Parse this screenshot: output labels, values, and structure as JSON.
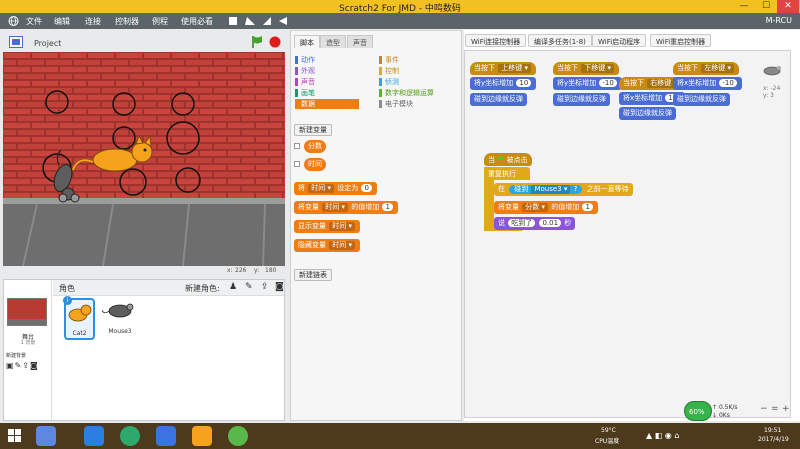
{
  "window": {
    "title": "Scratch2 For JMD - 中鸣数码",
    "min": "—",
    "max": "☐",
    "close": "✕"
  },
  "menu": {
    "items": [
      "文件",
      "编辑",
      "连接",
      "控制器",
      "例程",
      "使用必看"
    ],
    "brand": "M-RCU"
  },
  "stage": {
    "version": "v456",
    "project_title": "Project",
    "coords": {
      "x_label": "x:",
      "x_value": "226",
      "y_label": "y:",
      "y_value": "180"
    }
  },
  "sprites": {
    "header_label": "角色",
    "new_sprite_label": "新建角色:",
    "stage_name": "舞台",
    "stage_backdrops": "1 背景",
    "new_backdrop_label": "新建背景",
    "list": [
      {
        "name": "Cat2",
        "selected": true
      },
      {
        "name": "Mouse3",
        "selected": false
      }
    ]
  },
  "palette": {
    "tabs": [
      "脚本",
      "造型",
      "声音"
    ],
    "categories": [
      {
        "label": "动作",
        "color": "#4a6cd4"
      },
      {
        "label": "外观",
        "color": "#8a55d7"
      },
      {
        "label": "声音",
        "color": "#bb42c3"
      },
      {
        "label": "画笔",
        "color": "#0e9a6c"
      },
      {
        "label": "数据",
        "color": "#ee7d16",
        "active": true
      },
      {
        "label": "事件",
        "color": "#c88330"
      },
      {
        "label": "控制",
        "color": "#e1a91a"
      },
      {
        "label": "侦测",
        "color": "#2ca5e2"
      },
      {
        "label": "数字和逻辑运算",
        "color": "#5cb712"
      },
      {
        "label": "电子模块",
        "color": "#8c8c8c"
      }
    ],
    "new_var_button": "新建变量",
    "variables": [
      "分数",
      "时间"
    ],
    "blocks": {
      "set": {
        "prefix": "将",
        "var": "时间",
        "mid": "设定为",
        "value": "0"
      },
      "change": {
        "prefix": "将变量",
        "var": "时间",
        "mid": "的值增加",
        "value": "1"
      },
      "show": {
        "prefix": "显示变量",
        "var": "时间"
      },
      "hide": {
        "prefix": "隐藏变量",
        "var": "时间"
      }
    },
    "new_list_button": "新建链表"
  },
  "toolbar": {
    "buttons": [
      "WiFi连接控制器",
      "编译多任务(1-8)",
      "WiFi启动程序",
      "WiFi重启控制器"
    ]
  },
  "scripts": {
    "s1": {
      "hat_prefix": "当按下",
      "hat_key": "上移键",
      "move_prefix": "将y坐标增加",
      "move_value": "10",
      "bounce": "碰到边缘就反弹"
    },
    "s2": {
      "hat_prefix": "当按下",
      "hat_key": "下移键",
      "move_prefix": "将y坐标增加",
      "move_value": "-10",
      "bounce": "碰到边缘就反弹"
    },
    "s3": {
      "hat_prefix": "当按下",
      "hat_key": "右移键",
      "move_prefix": "将x坐标增加",
      "move_value": "10",
      "bounce": "碰到边缘就反弹"
    },
    "s4": {
      "hat_prefix": "当按下",
      "hat_key": "左移键",
      "move_prefix": "将x坐标增加",
      "move_value": "-10",
      "bounce": "碰到边缘就反弹"
    },
    "main": {
      "hat_prefix": "当",
      "hat_suffix": "被点击",
      "forever": "重复执行",
      "wait_prefix": "在",
      "touching": "碰到",
      "touching_target": "Mouse3",
      "question": "?",
      "wait_suffix": "之前一直等待",
      "change_prefix": "将变量",
      "change_var": "分数",
      "change_mid": "的值增加",
      "change_value": "1",
      "say_prefix": "说",
      "say_text": "吃到了",
      "say_secs": "0.01",
      "say_suffix": "秒"
    },
    "sprite_info": {
      "x": "x: -24",
      "y": "y: 3"
    }
  },
  "zoom": {
    "out": "−",
    "reset": "=",
    "in": "+"
  },
  "netspeed": {
    "percent": "60%",
    "up": "0.5K/s",
    "down": "0Ks"
  },
  "taskbar": {
    "temp_value": "59°C",
    "temp_label": "CPU温度",
    "time": "19:51",
    "date": "2017/4/19"
  }
}
